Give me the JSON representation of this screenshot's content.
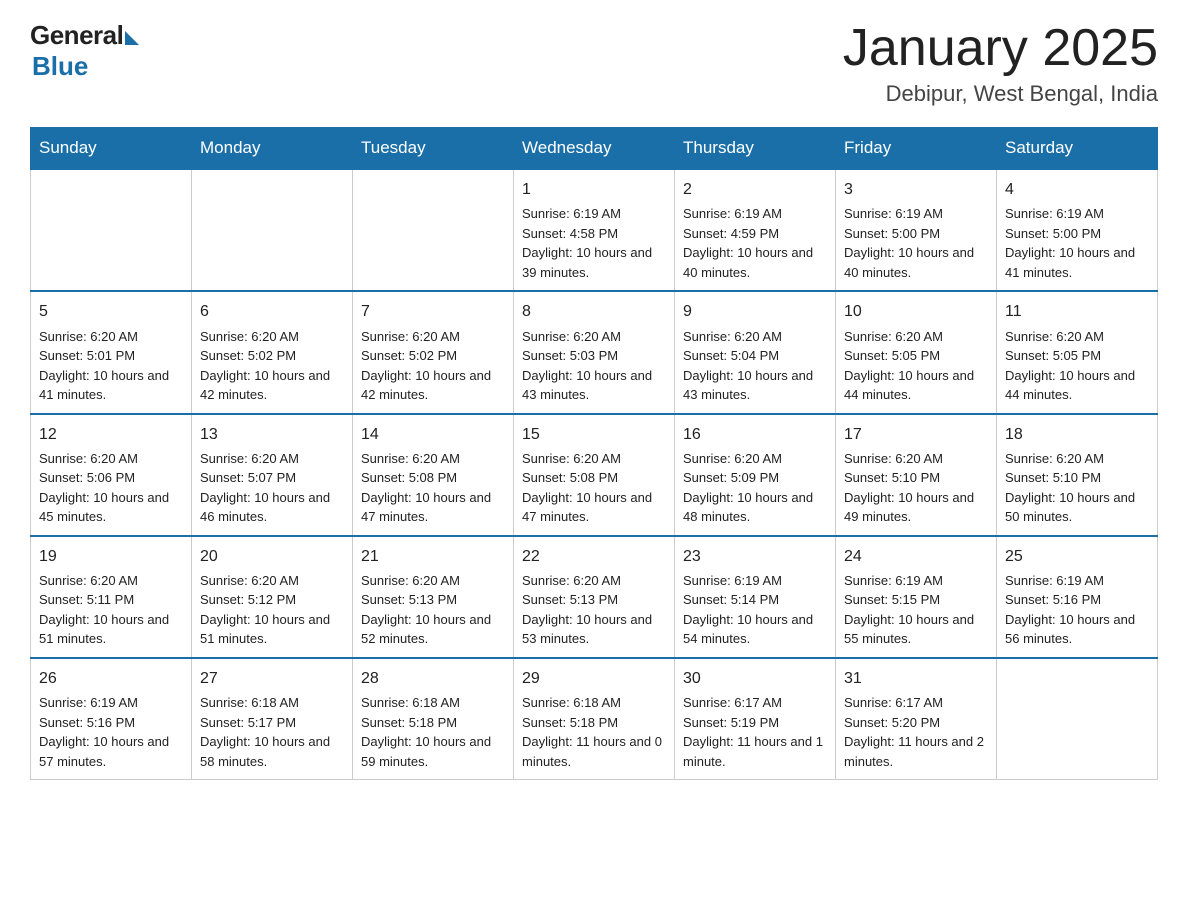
{
  "header": {
    "logo_general": "General",
    "logo_blue": "Blue",
    "title": "January 2025",
    "subtitle": "Debipur, West Bengal, India"
  },
  "days_of_week": [
    "Sunday",
    "Monday",
    "Tuesday",
    "Wednesday",
    "Thursday",
    "Friday",
    "Saturday"
  ],
  "weeks": [
    [
      {
        "day": "",
        "info": ""
      },
      {
        "day": "",
        "info": ""
      },
      {
        "day": "",
        "info": ""
      },
      {
        "day": "1",
        "info": "Sunrise: 6:19 AM\nSunset: 4:58 PM\nDaylight: 10 hours\nand 39 minutes."
      },
      {
        "day": "2",
        "info": "Sunrise: 6:19 AM\nSunset: 4:59 PM\nDaylight: 10 hours\nand 40 minutes."
      },
      {
        "day": "3",
        "info": "Sunrise: 6:19 AM\nSunset: 5:00 PM\nDaylight: 10 hours\nand 40 minutes."
      },
      {
        "day": "4",
        "info": "Sunrise: 6:19 AM\nSunset: 5:00 PM\nDaylight: 10 hours\nand 41 minutes."
      }
    ],
    [
      {
        "day": "5",
        "info": "Sunrise: 6:20 AM\nSunset: 5:01 PM\nDaylight: 10 hours\nand 41 minutes."
      },
      {
        "day": "6",
        "info": "Sunrise: 6:20 AM\nSunset: 5:02 PM\nDaylight: 10 hours\nand 42 minutes."
      },
      {
        "day": "7",
        "info": "Sunrise: 6:20 AM\nSunset: 5:02 PM\nDaylight: 10 hours\nand 42 minutes."
      },
      {
        "day": "8",
        "info": "Sunrise: 6:20 AM\nSunset: 5:03 PM\nDaylight: 10 hours\nand 43 minutes."
      },
      {
        "day": "9",
        "info": "Sunrise: 6:20 AM\nSunset: 5:04 PM\nDaylight: 10 hours\nand 43 minutes."
      },
      {
        "day": "10",
        "info": "Sunrise: 6:20 AM\nSunset: 5:05 PM\nDaylight: 10 hours\nand 44 minutes."
      },
      {
        "day": "11",
        "info": "Sunrise: 6:20 AM\nSunset: 5:05 PM\nDaylight: 10 hours\nand 44 minutes."
      }
    ],
    [
      {
        "day": "12",
        "info": "Sunrise: 6:20 AM\nSunset: 5:06 PM\nDaylight: 10 hours\nand 45 minutes."
      },
      {
        "day": "13",
        "info": "Sunrise: 6:20 AM\nSunset: 5:07 PM\nDaylight: 10 hours\nand 46 minutes."
      },
      {
        "day": "14",
        "info": "Sunrise: 6:20 AM\nSunset: 5:08 PM\nDaylight: 10 hours\nand 47 minutes."
      },
      {
        "day": "15",
        "info": "Sunrise: 6:20 AM\nSunset: 5:08 PM\nDaylight: 10 hours\nand 47 minutes."
      },
      {
        "day": "16",
        "info": "Sunrise: 6:20 AM\nSunset: 5:09 PM\nDaylight: 10 hours\nand 48 minutes."
      },
      {
        "day": "17",
        "info": "Sunrise: 6:20 AM\nSunset: 5:10 PM\nDaylight: 10 hours\nand 49 minutes."
      },
      {
        "day": "18",
        "info": "Sunrise: 6:20 AM\nSunset: 5:10 PM\nDaylight: 10 hours\nand 50 minutes."
      }
    ],
    [
      {
        "day": "19",
        "info": "Sunrise: 6:20 AM\nSunset: 5:11 PM\nDaylight: 10 hours\nand 51 minutes."
      },
      {
        "day": "20",
        "info": "Sunrise: 6:20 AM\nSunset: 5:12 PM\nDaylight: 10 hours\nand 51 minutes."
      },
      {
        "day": "21",
        "info": "Sunrise: 6:20 AM\nSunset: 5:13 PM\nDaylight: 10 hours\nand 52 minutes."
      },
      {
        "day": "22",
        "info": "Sunrise: 6:20 AM\nSunset: 5:13 PM\nDaylight: 10 hours\nand 53 minutes."
      },
      {
        "day": "23",
        "info": "Sunrise: 6:19 AM\nSunset: 5:14 PM\nDaylight: 10 hours\nand 54 minutes."
      },
      {
        "day": "24",
        "info": "Sunrise: 6:19 AM\nSunset: 5:15 PM\nDaylight: 10 hours\nand 55 minutes."
      },
      {
        "day": "25",
        "info": "Sunrise: 6:19 AM\nSunset: 5:16 PM\nDaylight: 10 hours\nand 56 minutes."
      }
    ],
    [
      {
        "day": "26",
        "info": "Sunrise: 6:19 AM\nSunset: 5:16 PM\nDaylight: 10 hours\nand 57 minutes."
      },
      {
        "day": "27",
        "info": "Sunrise: 6:18 AM\nSunset: 5:17 PM\nDaylight: 10 hours\nand 58 minutes."
      },
      {
        "day": "28",
        "info": "Sunrise: 6:18 AM\nSunset: 5:18 PM\nDaylight: 10 hours\nand 59 minutes."
      },
      {
        "day": "29",
        "info": "Sunrise: 6:18 AM\nSunset: 5:18 PM\nDaylight: 11 hours\nand 0 minutes."
      },
      {
        "day": "30",
        "info": "Sunrise: 6:17 AM\nSunset: 5:19 PM\nDaylight: 11 hours\nand 1 minute."
      },
      {
        "day": "31",
        "info": "Sunrise: 6:17 AM\nSunset: 5:20 PM\nDaylight: 11 hours\nand 2 minutes."
      },
      {
        "day": "",
        "info": ""
      }
    ]
  ]
}
